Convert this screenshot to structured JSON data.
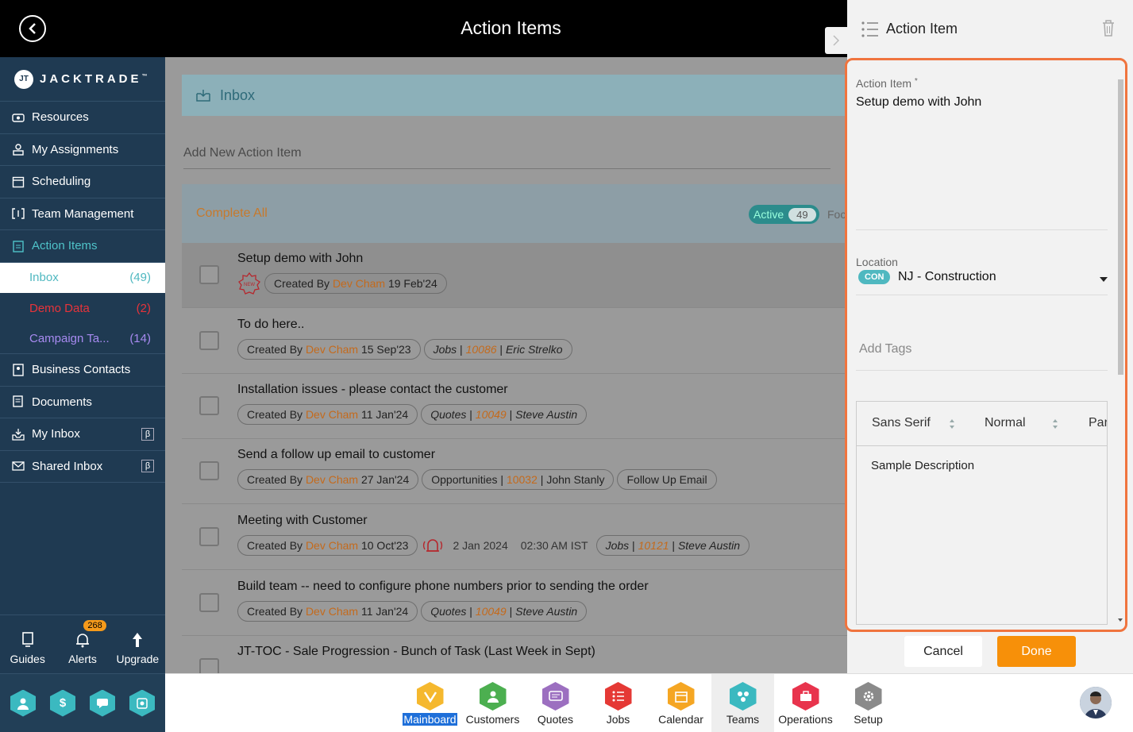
{
  "header": {
    "title": "Action Items"
  },
  "brand": {
    "name": "JACKTRADE",
    "mark": "JT",
    "trademark": "™"
  },
  "sidebar": {
    "items": [
      {
        "label": "Resources",
        "icon": "resources-icon"
      },
      {
        "label": "My Assignments",
        "icon": "assignments-icon"
      },
      {
        "label": "Scheduling",
        "icon": "scheduling-icon"
      },
      {
        "label": "Team Management",
        "icon": "team-icon"
      },
      {
        "label": "Action Items",
        "icon": "clipboard-icon"
      }
    ],
    "subitems": [
      {
        "label": "Inbox",
        "count": "(49)"
      },
      {
        "label": "Demo Data",
        "count": "(2)"
      },
      {
        "label": "Campaign Ta...",
        "count": "(14)"
      }
    ],
    "items2": [
      {
        "label": "Business Contacts",
        "icon": "contacts-icon"
      },
      {
        "label": "Documents",
        "icon": "documents-icon"
      },
      {
        "label": "My Inbox",
        "icon": "inbox-icon",
        "beta": "β"
      },
      {
        "label": "Shared Inbox",
        "icon": "mail-icon",
        "beta": "β"
      }
    ],
    "bottom": {
      "guides": "Guides",
      "alerts": "Alerts",
      "alerts_count": "268",
      "upgrade": "Upgrade"
    }
  },
  "main": {
    "section_title": "Inbox",
    "add_placeholder": "Add New Action Item",
    "complete_all": "Complete All",
    "active_label": "Active",
    "active_count": "49",
    "focus_partial": "Foc",
    "rows": [
      {
        "title": "Setup demo with John",
        "new_badge": "NEW",
        "created_prefix": "Created By ",
        "author": "Dev Cham",
        "date": " 19 Feb'24"
      },
      {
        "title": "To do here..",
        "created_prefix": "Created By ",
        "author": "Dev Cham",
        "date": " 15 Sep'23",
        "link_type": "Jobs",
        "link_id": "10086",
        "link_name": "Eric Strelko"
      },
      {
        "title": "Installation issues - please contact the customer",
        "created_prefix": "Created By ",
        "author": "Dev Cham",
        "date": " 11 Jan'24",
        "link_type": "Quotes",
        "link_id": "10049",
        "link_name": "Steve Austin"
      },
      {
        "title": "Send a follow up email to customer",
        "created_prefix": "Created By ",
        "author": "Dev Cham",
        "date": " 27 Jan'24",
        "link_type": "Opportunities",
        "link_id": "10032",
        "link_name": "John Stanly",
        "tag": "Follow Up Email"
      },
      {
        "title": "Meeting with Customer",
        "created_prefix": "Created By ",
        "author": "Dev Cham",
        "date": " 10 Oct'23",
        "reminder_date": "2 Jan 2024",
        "reminder_time": "02:30 AM IST",
        "link_type": "Jobs",
        "link_id": "10121",
        "link_name": "Steve Austin"
      },
      {
        "title": "Build team -- need to configure phone numbers prior to sending the order",
        "created_prefix": "Created By ",
        "author": "Dev Cham",
        "date": " 11 Jan'24",
        "link_type": "Quotes",
        "link_id": "10049",
        "link_name": "Steve Austin"
      },
      {
        "title": "JT-TOC - Sale Progression - Bunch of Task (Last Week in Sept)"
      }
    ]
  },
  "panel": {
    "title": "Action Item",
    "action_item_label": "Action Item",
    "required_mark": "*",
    "action_item_value": "Setup demo with John",
    "location_label": "Location",
    "location_badge": "CON",
    "location_value": "NJ - Construction",
    "tags_placeholder": "Add Tags",
    "font_family": "Sans Serif",
    "font_size": "Normal",
    "paragraph": "Parag",
    "description": "Sample Description",
    "cancel": "Cancel",
    "done": "Done"
  },
  "bottomnav": {
    "items": [
      {
        "label": "Mainboard",
        "color": "#f5b82e"
      },
      {
        "label": "Customers",
        "color": "#4caf50"
      },
      {
        "label": "Quotes",
        "color": "#9c6fc0"
      },
      {
        "label": "Jobs",
        "color": "#e53935"
      },
      {
        "label": "Calendar",
        "color": "#f5a623"
      },
      {
        "label": "Teams",
        "color": "#3bb9c0"
      },
      {
        "label": "Operations",
        "color": "#e8344d"
      },
      {
        "label": "Setup",
        "color": "#8a8a8a"
      }
    ]
  },
  "colors": {
    "accent_orange": "#f79009",
    "teal": "#4fb8c0",
    "sidebar_bg": "#1f3a52",
    "focus_border": "#f0743e"
  }
}
